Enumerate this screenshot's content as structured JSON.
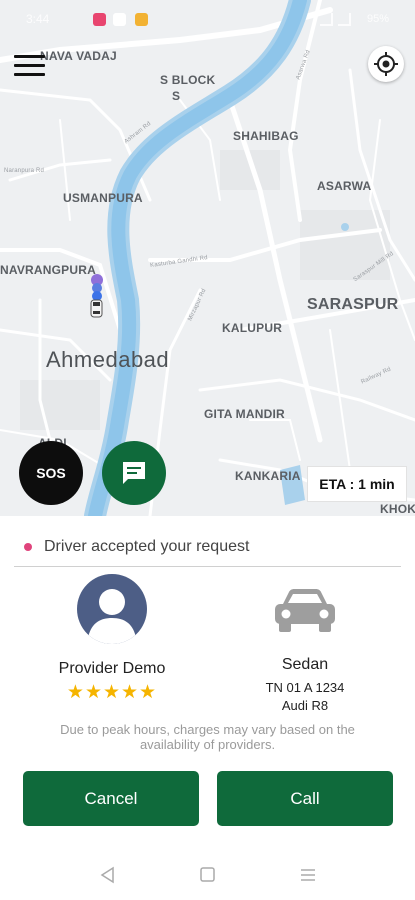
{
  "status_bar": {
    "time": "3:44",
    "battery": "95%",
    "notification_colors": [
      "#e8456f",
      "#ffffff",
      "#f2b233"
    ]
  },
  "map": {
    "labels": {
      "nava_vadaj": "NAVA VADAJ",
      "s_block": "S BLOCK",
      "s_block_2": "S",
      "shahibag": "SHAHIBAG",
      "asarwa": "ASARWA",
      "usmanpura": "USMANPURA",
      "navrangpura": "NAVRANGPURA",
      "saraspur": "SARASPUR",
      "kalupur": "KALUPUR",
      "ahmedabad": "Ahmedabad",
      "gita_mandir": "GITA MANDIR",
      "kankaria": "KANKARIA",
      "khokhra": "KHOK",
      "paldi": "ALDI",
      "naranpura": "Naranpura Rd",
      "ashram_rd": "Ashram Rd",
      "kasturba": "Kasturba Gandhi Rd",
      "mirzapur": "Mirzapur Rd",
      "asarwa_rd": "Asarwa Rd",
      "railway": "Railway Rd",
      "mill_rd": "Saraspur Mill Rd"
    },
    "colors": {
      "land": "#eef0f2",
      "river": "#a9d1ec",
      "river_edge": "#7cc0ea",
      "road": "#ffffff"
    }
  },
  "controls": {
    "sos_label": "SOS",
    "eta_label": "ETA : 1 min"
  },
  "request": {
    "status_text": "Driver accepted your request",
    "status_color": "#e0447c"
  },
  "provider": {
    "name": "Provider Demo",
    "rating_stars": "★★★★★",
    "rating": 5
  },
  "vehicle": {
    "type": "Sedan",
    "plate": "TN 01 A 1234",
    "model": "Audi R8"
  },
  "note": "Due to peak hours, charges may vary based on the availability of providers.",
  "actions": {
    "cancel_label": "Cancel",
    "call_label": "Call",
    "button_color": "#0f6a3b"
  },
  "system_nav": {
    "back_icon": "triangle-back",
    "home_icon": "square-home",
    "recents_icon": "lines-menu"
  }
}
